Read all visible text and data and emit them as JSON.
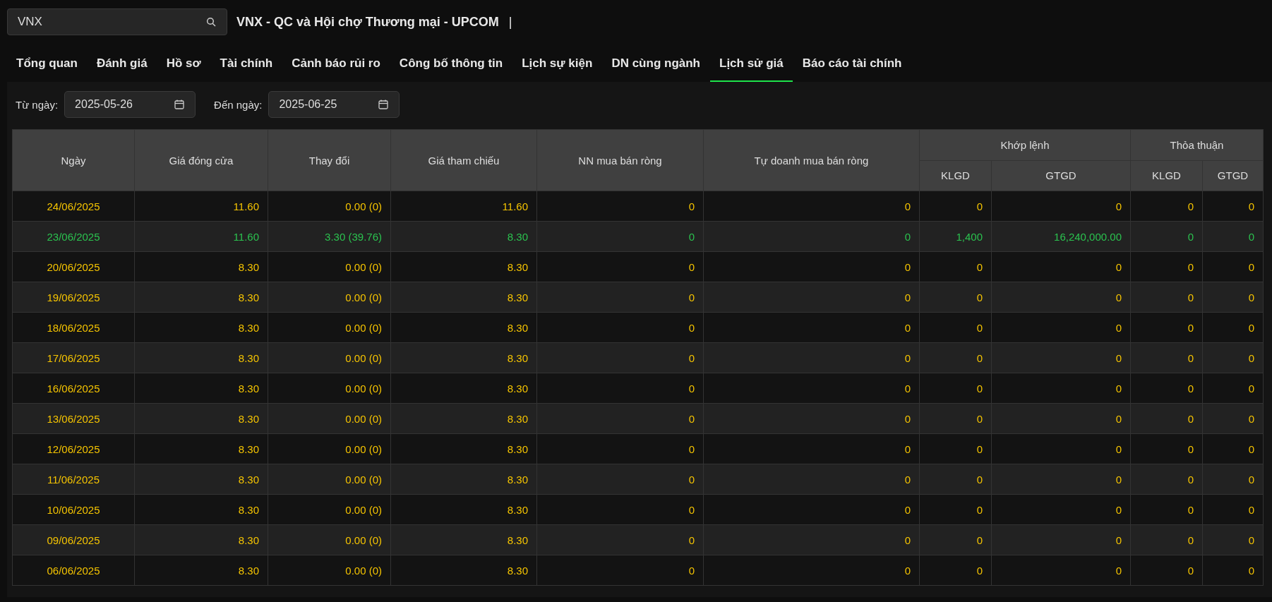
{
  "search": {
    "value": "VNX"
  },
  "title": "VNX - QC và Hội chợ Thương mại - UPCOM",
  "title_separator": "|",
  "tabs": [
    {
      "label": "Tổng quan",
      "selected": false
    },
    {
      "label": "Đánh giá",
      "selected": false
    },
    {
      "label": "Hồ sơ",
      "selected": false
    },
    {
      "label": "Tài chính",
      "selected": false
    },
    {
      "label": "Cảnh báo rủi ro",
      "selected": false
    },
    {
      "label": "Công bố thông tin",
      "selected": false
    },
    {
      "label": "Lịch sự kiện",
      "selected": false
    },
    {
      "label": "DN cùng ngành",
      "selected": false
    },
    {
      "label": "Lịch sử giá",
      "selected": true
    },
    {
      "label": "Báo cáo tài chính",
      "selected": false
    }
  ],
  "date_filters": [
    {
      "label": "Từ ngày:",
      "value": "2025-05-26"
    },
    {
      "label": "Đến ngày:",
      "value": "2025-06-25"
    }
  ],
  "table": {
    "header_rows": [
      [
        {
          "label": "Ngày",
          "rowspan": 2
        },
        {
          "label": "Giá đóng cửa",
          "rowspan": 2
        },
        {
          "label": "Thay đổi",
          "rowspan": 2
        },
        {
          "label": "Giá tham chiếu",
          "rowspan": 2
        },
        {
          "label": "NN mua bán ròng",
          "rowspan": 2
        },
        {
          "label": "Tự doanh mua bán ròng",
          "rowspan": 2
        },
        {
          "label": "Khớp lệnh",
          "colspan": 2
        },
        {
          "label": "Thỏa thuận",
          "colspan": 2
        }
      ],
      [
        {
          "label": "KLGD"
        },
        {
          "label": "GTGD"
        },
        {
          "label": "KLGD"
        },
        {
          "label": "GTGD"
        }
      ]
    ],
    "rows": [
      {
        "color": "#f5c400",
        "cells": [
          "24/06/2025",
          "11.60",
          "0.00 (0)",
          "11.60",
          "0",
          "0",
          "0",
          "0",
          "0",
          "0"
        ]
      },
      {
        "color": "#2bc24f",
        "cells": [
          "23/06/2025",
          "11.60",
          "3.30 (39.76)",
          "8.30",
          "0",
          "0",
          "1,400",
          "16,240,000.00",
          "0",
          "0"
        ]
      },
      {
        "color": "#f5c400",
        "cells": [
          "20/06/2025",
          "8.30",
          "0.00 (0)",
          "8.30",
          "0",
          "0",
          "0",
          "0",
          "0",
          "0"
        ]
      },
      {
        "color": "#f5c400",
        "cells": [
          "19/06/2025",
          "8.30",
          "0.00 (0)",
          "8.30",
          "0",
          "0",
          "0",
          "0",
          "0",
          "0"
        ]
      },
      {
        "color": "#f5c400",
        "cells": [
          "18/06/2025",
          "8.30",
          "0.00 (0)",
          "8.30",
          "0",
          "0",
          "0",
          "0",
          "0",
          "0"
        ]
      },
      {
        "color": "#f5c400",
        "cells": [
          "17/06/2025",
          "8.30",
          "0.00 (0)",
          "8.30",
          "0",
          "0",
          "0",
          "0",
          "0",
          "0"
        ]
      },
      {
        "color": "#f5c400",
        "cells": [
          "16/06/2025",
          "8.30",
          "0.00 (0)",
          "8.30",
          "0",
          "0",
          "0",
          "0",
          "0",
          "0"
        ]
      },
      {
        "color": "#f5c400",
        "cells": [
          "13/06/2025",
          "8.30",
          "0.00 (0)",
          "8.30",
          "0",
          "0",
          "0",
          "0",
          "0",
          "0"
        ]
      },
      {
        "color": "#f5c400",
        "cells": [
          "12/06/2025",
          "8.30",
          "0.00 (0)",
          "8.30",
          "0",
          "0",
          "0",
          "0",
          "0",
          "0"
        ]
      },
      {
        "color": "#f5c400",
        "cells": [
          "11/06/2025",
          "8.30",
          "0.00 (0)",
          "8.30",
          "0",
          "0",
          "0",
          "0",
          "0",
          "0"
        ]
      },
      {
        "color": "#f5c400",
        "cells": [
          "10/06/2025",
          "8.30",
          "0.00 (0)",
          "8.30",
          "0",
          "0",
          "0",
          "0",
          "0",
          "0"
        ]
      },
      {
        "color": "#f5c400",
        "cells": [
          "09/06/2025",
          "8.30",
          "0.00 (0)",
          "8.30",
          "0",
          "0",
          "0",
          "0",
          "0",
          "0"
        ]
      },
      {
        "color": "#f5c400",
        "cells": [
          "06/06/2025",
          "8.30",
          "0.00 (0)",
          "8.30",
          "0",
          "0",
          "0",
          "0",
          "0",
          "0"
        ]
      }
    ]
  }
}
